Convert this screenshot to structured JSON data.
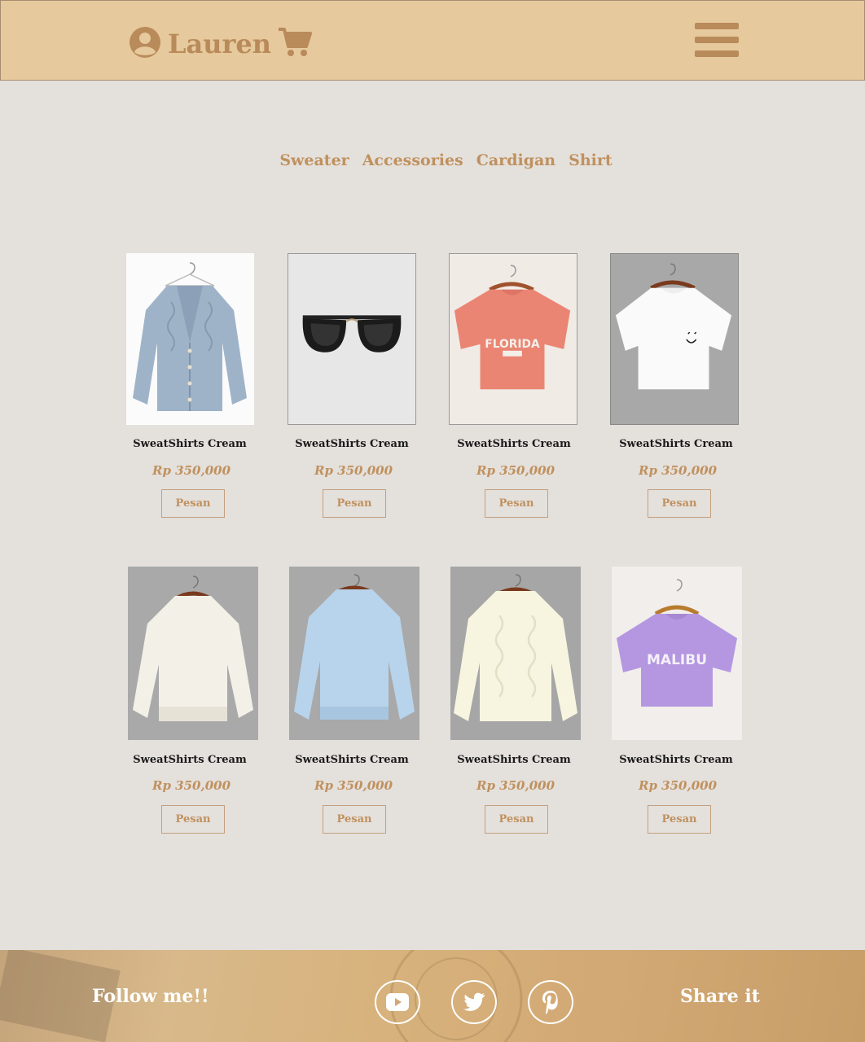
{
  "header": {
    "brand": "Lauren",
    "icons": {
      "user": "user-circle-icon",
      "cart": "shopping-cart-icon",
      "menu": "hamburger-menu-icon"
    },
    "color": "#e6c99c",
    "accent": "#b98a5a"
  },
  "categories": [
    "Sweater",
    "Accessories",
    "Cardigan",
    "Shirt"
  ],
  "products": [
    {
      "name": "SweatShirts Cream",
      "price": "Rp 350,000",
      "button": "Pesan",
      "image": "blue-knit-cardigan"
    },
    {
      "name": "SweatShirts Cream",
      "price": "Rp 350,000",
      "button": "Pesan",
      "image": "black-sunglasses"
    },
    {
      "name": "SweatShirts Cream",
      "price": "Rp 350,000",
      "button": "Pesan",
      "image": "coral-florida-tshirt",
      "print": "FLORIDA"
    },
    {
      "name": "SweatShirts Cream",
      "price": "Rp 350,000",
      "button": "Pesan",
      "image": "white-smiley-tshirt"
    },
    {
      "name": "SweatShirts Cream",
      "price": "Rp 350,000",
      "button": "Pesan",
      "image": "cream-fuzzy-sweater"
    },
    {
      "name": "SweatShirts Cream",
      "price": "Rp 350,000",
      "button": "Pesan",
      "image": "light-blue-sweatshirt"
    },
    {
      "name": "SweatShirts Cream",
      "price": "Rp 350,000",
      "button": "Pesan",
      "image": "cream-cable-knit-sweater"
    },
    {
      "name": "SweatShirts Cream",
      "price": "Rp 350,000",
      "button": "Pesan",
      "image": "lavender-malibu-tshirt",
      "print": "MALIBU"
    }
  ],
  "footer": {
    "follow": "Follow me!!",
    "share": "Share it",
    "social_icons": [
      "youtube-icon",
      "twitter-icon",
      "pinterest-icon"
    ]
  }
}
